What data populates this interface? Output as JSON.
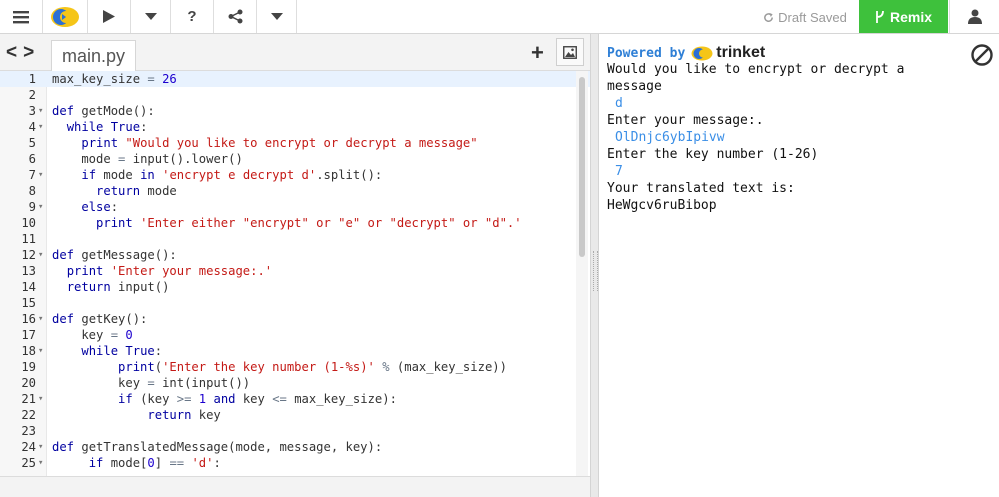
{
  "toolbar": {
    "draft_status": "Draft Saved",
    "remix_label": "Remix"
  },
  "editor": {
    "file_tab": "main.py",
    "lines": [
      {
        "n": "1",
        "fold": "",
        "html": "max_key_size <span class='op'>=</span> <span class='num'>26</span>"
      },
      {
        "n": "2",
        "fold": "",
        "html": ""
      },
      {
        "n": "3",
        "fold": "▾",
        "html": "<span class='kwd'>def</span> getMode():"
      },
      {
        "n": "4",
        "fold": "▾",
        "html": "  <span class='kwd'>while</span> <span class='kwd'>True</span>:"
      },
      {
        "n": "5",
        "fold": "",
        "html": "    <span class='kwd'>print</span> <span class='str'>\"Would you like to encrypt or decrypt a message\"</span>"
      },
      {
        "n": "6",
        "fold": "",
        "html": "    mode <span class='op'>=</span> input().lower()"
      },
      {
        "n": "7",
        "fold": "▾",
        "html": "    <span class='kwd'>if</span> mode <span class='kwd'>in</span> <span class='str'>'encrypt e decrypt d'</span>.split():"
      },
      {
        "n": "8",
        "fold": "",
        "html": "      <span class='kwd'>return</span> mode"
      },
      {
        "n": "9",
        "fold": "▾",
        "html": "    <span class='kwd'>else</span>:"
      },
      {
        "n": "10",
        "fold": "",
        "html": "      <span class='kwd'>print</span> <span class='str'>'Enter either \"encrypt\" or \"e\" or \"decrypt\" or \"d\".'</span>"
      },
      {
        "n": "11",
        "fold": "",
        "html": ""
      },
      {
        "n": "12",
        "fold": "▾",
        "html": "<span class='kwd'>def</span> getMessage():"
      },
      {
        "n": "13",
        "fold": "",
        "html": "  <span class='kwd'>print</span> <span class='str'>'Enter your message:.'</span>"
      },
      {
        "n": "14",
        "fold": "",
        "html": "  <span class='kwd'>return</span> input()"
      },
      {
        "n": "15",
        "fold": "",
        "html": ""
      },
      {
        "n": "16",
        "fold": "▾",
        "html": "<span class='kwd'>def</span> getKey():"
      },
      {
        "n": "17",
        "fold": "",
        "html": "    key <span class='op'>=</span> <span class='num'>0</span>"
      },
      {
        "n": "18",
        "fold": "▾",
        "html": "    <span class='kwd'>while</span> <span class='kwd'>True</span>:"
      },
      {
        "n": "19",
        "fold": "",
        "html": "         <span class='kwd'>print</span>(<span class='str'>'Enter the key number (1-%s)'</span> <span class='op'>%</span> (max_key_size))"
      },
      {
        "n": "20",
        "fold": "",
        "html": "         key <span class='op'>=</span> int(input())"
      },
      {
        "n": "21",
        "fold": "▾",
        "html": "         <span class='kwd'>if</span> (key <span class='op'>&gt;=</span> <span class='num'>1</span> <span class='kwd'>and</span> key <span class='op'>&lt;=</span> max_key_size):"
      },
      {
        "n": "22",
        "fold": "",
        "html": "             <span class='kwd'>return</span> key"
      },
      {
        "n": "23",
        "fold": "",
        "html": ""
      },
      {
        "n": "24",
        "fold": "▾",
        "html": "<span class='kwd'>def</span> getTranslatedMessage(mode, message, key):"
      },
      {
        "n": "25",
        "fold": "▾",
        "html": "     <span class='kwd'>if</span> mode[<span class='num'>0</span>] <span class='op'>==</span> <span class='str'>'d'</span>:"
      }
    ]
  },
  "output": {
    "powered_by": "Powered by",
    "brand": "trinket",
    "lines": [
      {
        "text": "Would you like to encrypt or decrypt a",
        "input": false
      },
      {
        "text": "message",
        "input": false
      },
      {
        "text": "d",
        "input": true
      },
      {
        "text": "Enter your message:.",
        "input": false
      },
      {
        "text": "OlDnjc6ybIpivw",
        "input": true
      },
      {
        "text": "Enter the key number (1-26)",
        "input": false
      },
      {
        "text": "7",
        "input": true
      },
      {
        "text": "Your translated text is:",
        "input": false
      },
      {
        "text": "HeWgcv6ruBibop",
        "input": false
      }
    ]
  }
}
